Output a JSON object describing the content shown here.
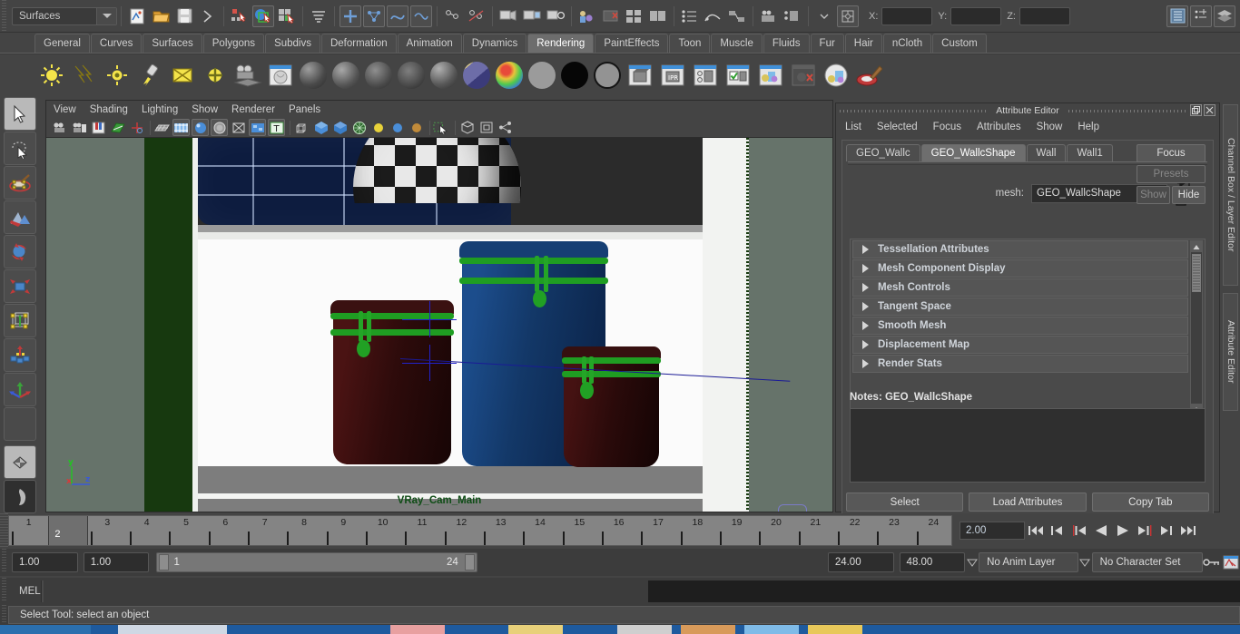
{
  "statusbar": {
    "menuset_value": "Surfaces",
    "coord_labels": [
      "X:",
      "Y:",
      "Z:"
    ],
    "coord_values": [
      "",
      "",
      ""
    ],
    "icons": [
      "new-scene-icon",
      "open-scene-icon",
      "save-scene-icon",
      "undo-arrow-icon",
      "select-by-hierarchy-icon",
      "select-by-object-icon",
      "select-by-component-icon",
      "snap-to-curve-icon",
      "snap-to-grid-icon",
      "snap-to-point-icon",
      "snap-to-view-plane-icon",
      "construction-history-icon",
      "render-current-frame-icon",
      "ipr-render-icon",
      "render-settings-icon",
      "toggle-sidebar-icon",
      "channel-box-icon",
      "attribute-editor-icon",
      "tool-settings-icon"
    ],
    "right_icons": [
      "show-channel-box-icon",
      "show-attribute-editor-icon",
      "show-layer-editor-icon"
    ]
  },
  "shelf": {
    "tabs": [
      {
        "label": "General",
        "active": false
      },
      {
        "label": "Curves",
        "active": false
      },
      {
        "label": "Surfaces",
        "active": false
      },
      {
        "label": "Polygons",
        "active": false
      },
      {
        "label": "Subdivs",
        "active": false
      },
      {
        "label": "Deformation",
        "active": false
      },
      {
        "label": "Animation",
        "active": false
      },
      {
        "label": "Dynamics",
        "active": false
      },
      {
        "label": "Rendering",
        "active": true
      },
      {
        "label": "PaintEffects",
        "active": false
      },
      {
        "label": "Toon",
        "active": false
      },
      {
        "label": "Muscle",
        "active": false
      },
      {
        "label": "Fluids",
        "active": false
      },
      {
        "label": "Fur",
        "active": false
      },
      {
        "label": "Hair",
        "active": false
      },
      {
        "label": "nCloth",
        "active": false
      },
      {
        "label": "Custom",
        "active": false
      }
    ],
    "items": [
      "point-light-icon",
      "directional-light-icon",
      "spot-light-icon",
      "area-light-icon",
      "ambient-light-icon",
      "volume-light-icon",
      "camera-icon",
      "render-view-icon",
      "anisotropic-shader-icon",
      "blinn-shader-icon",
      "lambert-shader-icon",
      "phong-shader-icon",
      "phonge-shader-icon",
      "layered-shader-icon",
      "ramp-shader-icon",
      "surface-shader-icon",
      "use-background-icon",
      "shading-map-icon",
      "batch-render-icon",
      "ipr-batch-render-icon",
      "render-globals-icon",
      "render-approve-icon",
      "hardware-render-icon",
      "hardware-render-off-icon",
      "render-layers-icon",
      "paint-effects-icon"
    ]
  },
  "toolbox": {
    "tools": [
      {
        "name": "select-tool",
        "selected": true
      },
      {
        "name": "lasso-select-tool",
        "selected": false
      },
      {
        "name": "paint-select-tool",
        "selected": false
      },
      {
        "name": "sculpt-tool",
        "selected": false
      },
      {
        "name": "rotate-tool",
        "selected": false
      },
      {
        "name": "scale-tool",
        "selected": false
      },
      {
        "name": "universal-manipulator-tool",
        "selected": false
      },
      {
        "name": "soft-modification-tool",
        "selected": false
      },
      {
        "name": "move-tool",
        "selected": false
      },
      {
        "name": "blank-tool-slot",
        "selected": false
      },
      {
        "name": "layout-quick-icon",
        "selected": false
      },
      {
        "name": "perspective-layout-icon",
        "selected": false
      }
    ]
  },
  "viewport": {
    "menus": [
      "View",
      "Shading",
      "Lighting",
      "Show",
      "Renderer",
      "Panels"
    ],
    "toolbar_icons": [
      "select-camera-icon",
      "camera-attributes-icon",
      "bookmark-icon",
      "image-plane-icon",
      "two-d-pan-zoom-icon",
      "grid-toggle-icon",
      "film-gate-icon",
      "resolution-gate-icon",
      "gate-mask-icon",
      "exposure-icon",
      "texture-toggle-icon",
      "text-toggle-icon",
      "wireframe-shading-icon",
      "smooth-shading-icon",
      "smooth-shaded-textured-icon",
      "xray-shading-icon",
      "default-light-icon",
      "all-lights-icon",
      "shadows-icon",
      "isolate-select-icon",
      "xray-joints-icon",
      "xray-icon",
      "panel-share-icon"
    ],
    "camera_label": "VRay_Cam_Main",
    "axis_labels": {
      "x": "x",
      "y": "y",
      "z": "z"
    }
  },
  "attribute_editor": {
    "title": "Attribute Editor",
    "window_buttons": [
      "restore-window-icon",
      "close-window-icon"
    ],
    "menus": [
      "List",
      "Selected",
      "Focus",
      "Attributes",
      "Show",
      "Help"
    ],
    "tabs": [
      {
        "label": "GEO_Wallc",
        "active": false
      },
      {
        "label": "GEO_WallcShape",
        "active": true
      },
      {
        "label": "Wall",
        "active": false
      },
      {
        "label": "Wall1",
        "active": false
      }
    ],
    "mesh_label": "mesh:",
    "mesh_value": "GEO_WallcShape",
    "buttons": {
      "focus": "Focus",
      "presets": "Presets",
      "show": "Show",
      "hide": "Hide"
    },
    "rollups": [
      "Tessellation Attributes",
      "Mesh Component Display",
      "Mesh Controls",
      "Tangent Space",
      "Smooth Mesh",
      "Displacement Map",
      "Render Stats"
    ],
    "notes_label": "Notes:  GEO_WallcShape",
    "notes_value": "",
    "footer_buttons": [
      "Select",
      "Load Attributes",
      "Copy Tab"
    ],
    "side_tabs": [
      "Channel Box / Layer Editor",
      "Attribute Editor"
    ]
  },
  "timeline": {
    "ticks": [
      1,
      2,
      3,
      4,
      5,
      6,
      7,
      8,
      9,
      10,
      11,
      12,
      13,
      14,
      15,
      16,
      17,
      18,
      19,
      20,
      21,
      22,
      23,
      24
    ],
    "current_frame_label": "2",
    "current_time_field": "2.00",
    "playback_buttons": [
      "go-to-start-icon",
      "step-back-keyframe-icon",
      "step-back-frame-icon",
      "play-backwards-icon",
      "play-forwards-icon",
      "step-forward-frame-icon",
      "step-forward-keyframe-icon",
      "go-to-end-icon"
    ]
  },
  "range_row": {
    "anim_start": "1.00",
    "range_start": "1.00",
    "range_bar_left": "1",
    "range_bar_right": "24",
    "range_end": "24.00",
    "anim_end": "48.00",
    "anim_layer": "No Anim Layer",
    "character_set": "No Character Set",
    "right_icons": [
      "auto-key-icon",
      "animation-preferences-icon"
    ]
  },
  "command_line": {
    "language_label": "MEL",
    "input_value": ""
  },
  "help_line": {
    "text": "Select Tool: select an object"
  },
  "colors": {
    "panel_bg": "#444444",
    "dark_field": "#2d2d2d",
    "accent_green": "#1f9d22",
    "camera_label_green": "#0f4d16",
    "tab_active": "#6e6e6e",
    "timeline_bg": "#848484",
    "viewport_wall": "#66736a",
    "jar_dark_red": "#3a1010",
    "jar_blue": "#12326b"
  }
}
